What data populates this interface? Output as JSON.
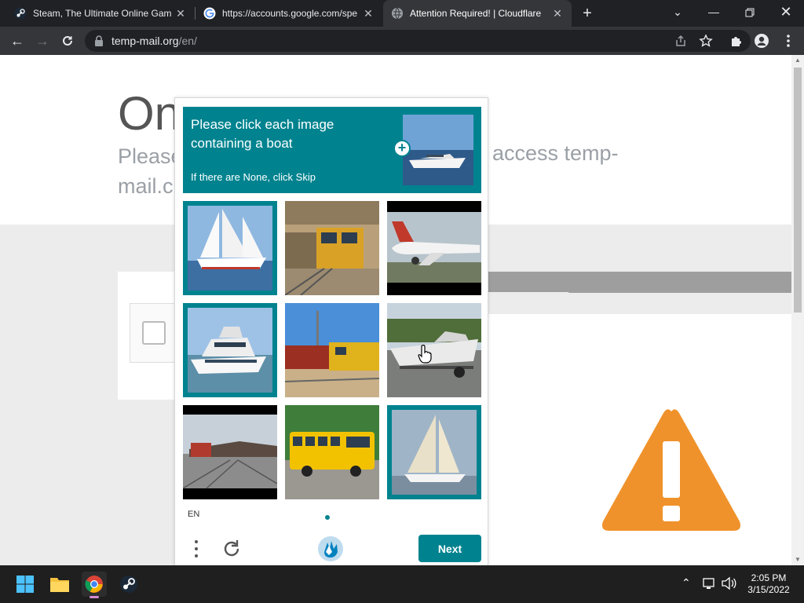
{
  "browser": {
    "tabs": [
      {
        "title": "Steam, The Ultimate Online Gam",
        "favicon": "steam-icon",
        "active": false
      },
      {
        "title": "https://accounts.google.com/spe",
        "favicon": "google-icon",
        "active": false
      },
      {
        "title": "Attention Required! | Cloudflare",
        "favicon": "globe-icon",
        "active": true
      }
    ],
    "address": {
      "domain": "temp-mail.org",
      "path": "/en/"
    }
  },
  "page": {
    "heading": "On",
    "subtext_left": "Please",
    "subtext_left_line2": "mail.c",
    "subtext_right": "access temp-"
  },
  "captcha": {
    "prompt": "Please click each image containing a boat",
    "subprompt": "If there are None, click Skip",
    "tiles": [
      {
        "subject": "sailboat",
        "selected": true
      },
      {
        "subject": "train",
        "selected": false
      },
      {
        "subject": "airplane",
        "selected": false
      },
      {
        "subject": "yacht",
        "selected": true
      },
      {
        "subject": "train",
        "selected": false
      },
      {
        "subject": "boat on trailer",
        "selected": false
      },
      {
        "subject": "train",
        "selected": false
      },
      {
        "subject": "school bus",
        "selected": false
      },
      {
        "subject": "sailboat",
        "selected": true
      }
    ],
    "language": "EN",
    "next_label": "Next",
    "accent_color": "#00838f"
  },
  "taskbar": {
    "apps": [
      "windows-start-icon",
      "file-explorer-icon",
      "chrome-icon",
      "steam-icon"
    ],
    "time": "2:05 PM",
    "date": "3/15/2022"
  },
  "warning_color": "#f0922b"
}
